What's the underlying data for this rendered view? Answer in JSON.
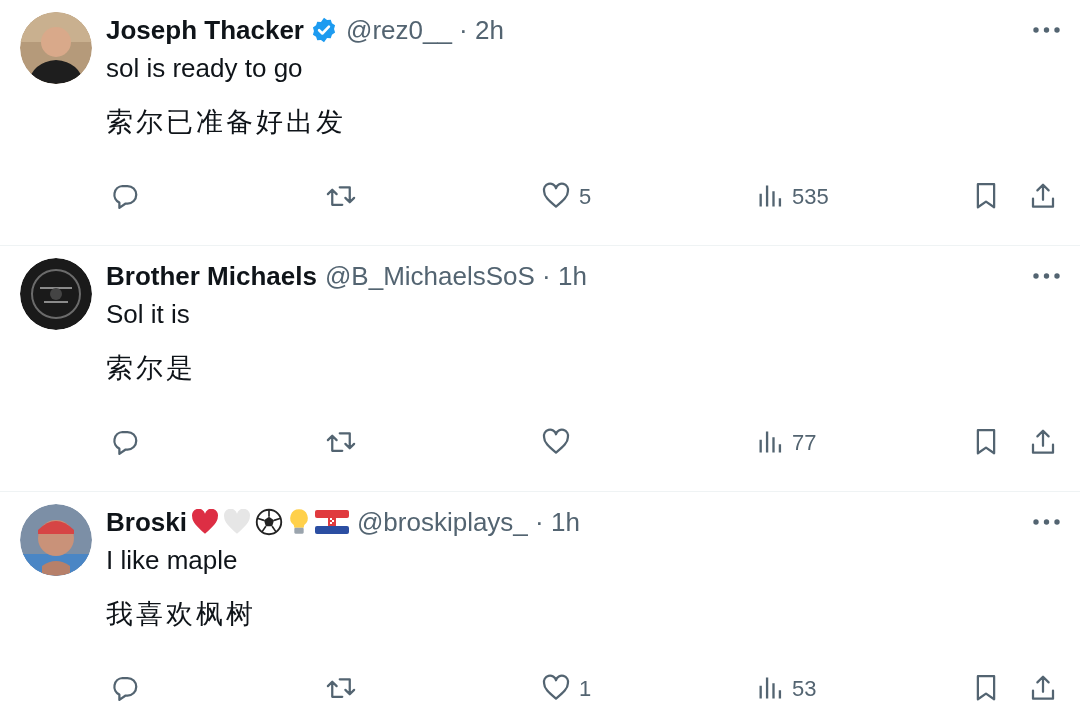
{
  "tweets": [
    {
      "author": "Joseph Thacker",
      "verified": true,
      "meta": "@rez0__ · 2h",
      "text": "sol is ready to go",
      "translation": "索尔已准备好出发",
      "likes": "5",
      "views": "535"
    },
    {
      "author": "Brother Michaels",
      "verified": false,
      "meta": "@B_MichaelsSoS · 1h",
      "text": "Sol it is",
      "translation": "索尔是",
      "views": "77"
    },
    {
      "author": "Broski",
      "verified": false,
      "name_icons": [
        {
          "kind": "heart",
          "color": "#dd2e44"
        },
        {
          "kind": "heart",
          "color": "#e6e6e6"
        },
        {
          "kind": "soccer_ball"
        },
        {
          "kind": "bulb"
        },
        {
          "kind": "flag"
        }
      ],
      "meta": "@broskiplays_ · 1h",
      "text": "I like maple",
      "translation": "我喜欢枫树",
      "likes": "1",
      "views": "53"
    }
  ]
}
